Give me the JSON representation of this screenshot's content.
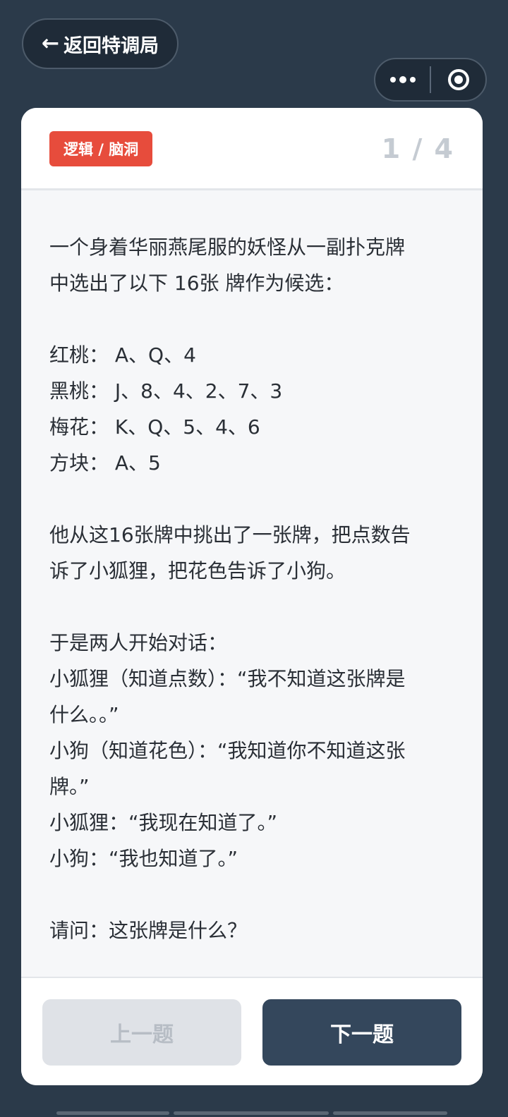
{
  "nav": {
    "back_label": "返回特调局",
    "back_icon": "arrow-left-icon"
  },
  "capsule": {
    "more_icon": "more-dots-icon",
    "close_icon": "target-circle-icon"
  },
  "card": {
    "tag": "逻辑 / 脑洞",
    "tag_color": "#e74c3c",
    "progress": "1 / 4",
    "question_lines": [
      "一个身着华丽燕尾服的妖怪从一副扑克牌",
      "中选出了以下 16张 牌作为候选：",
      "",
      "红桃： A、Q、4",
      "黑桃： J、8、4、2、7、3",
      "梅花： K、Q、5、4、6",
      "方块： A、5",
      "",
      "他从这16张牌中挑出了一张牌，把点数告",
      "诉了小狐狸，把花色告诉了小狗。",
      "",
      "于是两人开始对话：",
      "小狐狸（知道点数）：“我不知道这张牌是",
      "什么。。”",
      "小狗（知道花色）：“我知道你不知道这张",
      "牌。”",
      "小狐狸：“我现在知道了。”",
      "小狗：“我也知道了。”",
      "",
      "请问：这张牌是什么？"
    ]
  },
  "footer": {
    "prev_label": "上一题",
    "next_label": "下一题"
  },
  "colors": {
    "background": "#2b3a4a",
    "next_button": "#34475c",
    "prev_button_disabled": "#dfe2e7"
  }
}
